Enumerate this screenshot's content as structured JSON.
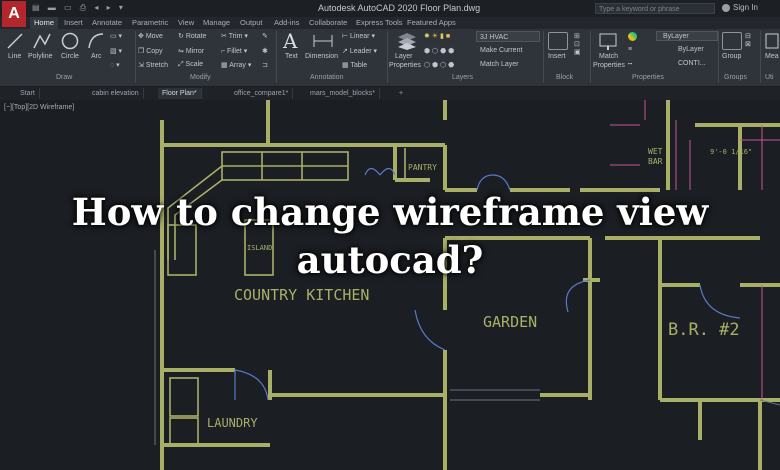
{
  "titlebar": {
    "app_logo": "A",
    "title": "Autodesk AutoCAD 2020   Floor Plan.dwg",
    "search_placeholder": "Type a keyword or phrase",
    "sign_in": "Sign In"
  },
  "ribbon_tabs": [
    "Home",
    "Insert",
    "Annotate",
    "Parametric",
    "View",
    "Manage",
    "Output",
    "Add-ins",
    "Collaborate",
    "Express Tools",
    "Featured Apps"
  ],
  "draw": {
    "line": "Line",
    "polyline": "Polyline",
    "circle": "Circle",
    "arc": "Arc",
    "panel": "Draw"
  },
  "modify": {
    "move": "Move",
    "rotate": "Rotate",
    "trim": "Trim",
    "copy": "Copy",
    "mirror": "Mirror",
    "fillet": "Fillet",
    "stretch": "Stretch",
    "scale": "Scale",
    "array": "Array",
    "panel": "Modify"
  },
  "annotation": {
    "text": "Text",
    "dimension": "Dimension",
    "linear": "Linear",
    "leader": "Leader",
    "table": "Table",
    "panel": "Annotation"
  },
  "layers": {
    "properties_line1": "Layer",
    "properties_line2": "Properties",
    "current": "3J HVAC",
    "make_current": "Make Current",
    "match_layer": "Match Layer",
    "panel": "Layers"
  },
  "block": {
    "insert": "Insert",
    "panel": "Block"
  },
  "properties": {
    "match_line1": "Match",
    "match_line2": "Properties",
    "color": "ByLayer",
    "lineweight": "ByLayer",
    "linetype": "CONTI...",
    "panel": "Properties"
  },
  "groups": {
    "group": "Group",
    "panel": "Groups"
  },
  "utilities": {
    "measure": "Mea",
    "panel": "Uti"
  },
  "doc_tabs": [
    "Start",
    "cabin elevation",
    "Floor Plan*",
    "office_compare1*",
    "mars_model_blocks*"
  ],
  "viewport_label": "[−][Top][2D Wireframe]",
  "rooms": {
    "pantry": "PANTRY",
    "island": "ISLAND",
    "country_kitchen": "COUNTRY KITCHEN",
    "garden": "GARDEN",
    "laundry": "LAUNDRY",
    "wet_bar_1": "WET",
    "wet_bar_2": "BAR",
    "dim_note": "9'-0 1/16\"",
    "br2": "B.R. #2"
  },
  "overlay": {
    "line1": "How to change wireframe view",
    "line2": "autocad?"
  },
  "colors": {
    "wall": "#a8b068",
    "accent_red": "#b3262b",
    "dim_line": "#c8579a"
  }
}
